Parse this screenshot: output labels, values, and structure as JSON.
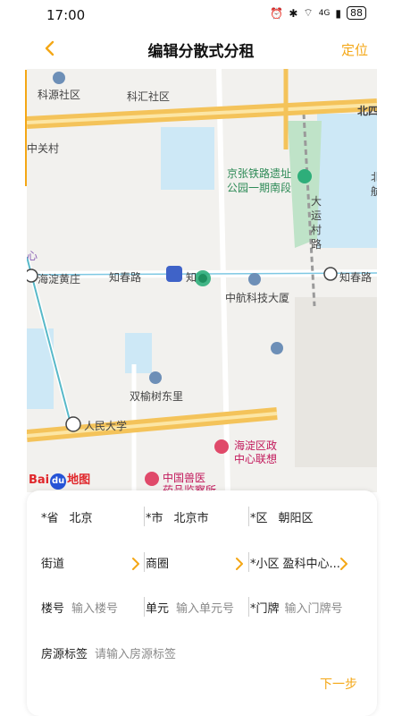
{
  "status_bar": {
    "time": "17:00",
    "signal": "4G",
    "battery": "88"
  },
  "header": {
    "title": "编辑分散式分租",
    "locate_label": "定位"
  },
  "map": {
    "labels": {
      "keyuan": "科源社区",
      "kehui": "科汇社区",
      "zhongguancun": "中关村",
      "jingzhang": "京张铁路遗址",
      "gongyuan": "公园一期南段",
      "dayun": "大运村路",
      "haidian_huang": "海淀黄庄",
      "zhichun_left": "知春路",
      "zhi": "知",
      "zhichun_right": "知春路",
      "zhonghang": "中航科技大厦",
      "shuangyu": "双榆树东里",
      "renmin": "人民大学",
      "haidian_zheng": "海淀区政",
      "zhongxin_lian": "中心联想",
      "zhongguo_shouyi": "中国兽医",
      "yaopin": "药品监察所",
      "bei_si": "北四",
      "xin": "心",
      "bei": "北",
      "hang": "航"
    },
    "logo": {
      "bai": "Bai",
      "du": "du",
      "ditu": "地图"
    },
    "colors": {
      "expressway": "#F4C35A",
      "water": "#CDE8F6",
      "park": "#BFE3C8",
      "marker": "#2EAE7A"
    }
  },
  "form": {
    "province": {
      "label": "*省",
      "value": "北京"
    },
    "city": {
      "label": "*市",
      "value": "北京市"
    },
    "district": {
      "label": "*区",
      "value": "朝阳区"
    },
    "street": {
      "label": "街道",
      "value": ""
    },
    "business_circle": {
      "label": "商圈",
      "value": ""
    },
    "community": {
      "label": "*小区",
      "value": "盈科中心..."
    },
    "building": {
      "label": "楼号",
      "placeholder": "输入楼号"
    },
    "unit": {
      "label": "单元",
      "placeholder": "输入单元号"
    },
    "door": {
      "label": "*门牌",
      "placeholder": "输入门牌号"
    },
    "tag": {
      "label": "房源标签",
      "placeholder": "请输入房源标签"
    },
    "next_label": "下一步"
  },
  "accent_color": "#F4A716"
}
